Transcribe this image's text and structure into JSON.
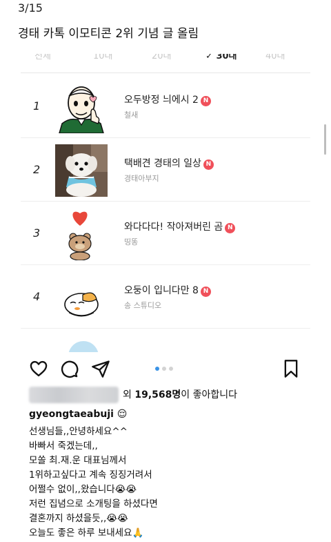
{
  "header": {
    "page_num": "3/15",
    "title": "경태 카톡 이모티콘 2위 기념 글 올림"
  },
  "filters": [
    {
      "label": "전체",
      "active": false
    },
    {
      "label": "10대",
      "active": false
    },
    {
      "label": "20대",
      "active": false
    },
    {
      "label": "30대",
      "active": true
    },
    {
      "label": "40대",
      "active": false
    }
  ],
  "ranking": [
    {
      "rank": "1",
      "title": "오두방정 늬에시 2",
      "author": "철새",
      "badge": "N",
      "icon": "bald-man-thumbs-up-icon"
    },
    {
      "rank": "2",
      "title": "택배견 경태의 일상",
      "author": "경태아부지",
      "badge": "N",
      "icon": "white-dog-photo"
    },
    {
      "rank": "3",
      "title": "와다다다! 작아져버린 곰",
      "author": "띵똥",
      "badge": "N",
      "icon": "bear-with-heart-icon"
    },
    {
      "rank": "4",
      "title": "오둥이 입니다만 8",
      "author": "송 스튜디오",
      "badge": "N",
      "icon": "sleeping-duck-icon"
    }
  ],
  "post": {
    "likes_prefix": "외",
    "likes_count": "19,568명",
    "likes_suffix": "이 좋아합니다",
    "username": "gyeongtaeabuji 😌",
    "caption_lines": [
      "선생님들,,안녕하세요^^",
      "바빠서 죽겠는데,,",
      "모쏠 최.재.운 대표님께서",
      "1위하고싶다고 계속 징징거려서",
      "어쩔수 없이,,왔습니다😭😭",
      "저런 집념으로 소개팅을 하셨다면",
      "결혼까지 하셨을듯,,😭😭",
      "오늘도 좋은 하루 보내세요🙏"
    ]
  },
  "colors": {
    "badge": "#f0505a",
    "dot_active": "#3a93e6"
  }
}
